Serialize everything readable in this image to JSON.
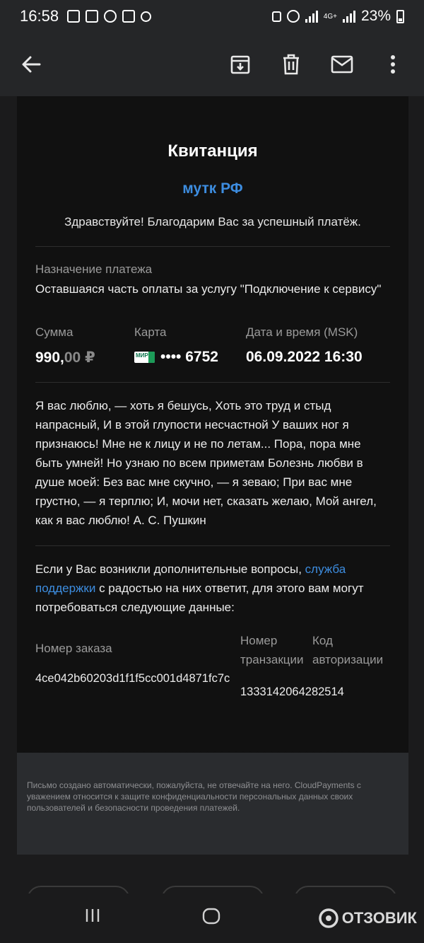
{
  "status_bar": {
    "time": "16:58",
    "network": "4G+",
    "battery": "23%"
  },
  "toolbar": {
    "back_icon": "arrow-left-icon",
    "archive_icon": "archive-icon",
    "delete_icon": "trash-icon",
    "mail_icon": "mail-icon",
    "more_icon": "more-vertical-icon"
  },
  "receipt": {
    "title": "Квитанция",
    "merchant": "мутк РФ",
    "greeting": "Здравствуйте! Благодарим Вас за успешный платёж.",
    "purpose_label": "Назначение платежа",
    "purpose_value": "Оставшаяся часть оплаты за услугу \"Подключение к сервису\"",
    "amount_label": "Сумма",
    "amount_main": "990,",
    "amount_cents": "00 ₽",
    "card_label": "Карта",
    "card_brand": "МИР",
    "card_number": "•••• 6752",
    "datetime_label": "Дата и время (MSK)",
    "datetime_value": "06.09.2022 16:30",
    "message": "Я вас люблю, — хоть я бешусь, Хоть это труд и стыд напрасный, И в этой глупости несчастной У ваших ног я признаюсь! Мне не к лицу и не по летам... Пора, пора мне быть умней! Но узнаю по всем приметам Болезнь любви в душе моей: Без вас мне скучно, — я зеваю; При вас мне грустно, — я терплю; И, мочи нет, сказать желаю, Мой ангел, как я вас люблю! А. С. Пушкин",
    "support_before": "Если у Вас возникли дополнительные вопросы, ",
    "support_link": "служба поддержки",
    "support_after": " с радостью на них ответит, для этого вам могут потребоваться следующие данные:",
    "order_label": "Номер заказа",
    "order_value": "4ce042b60203d1f1f5cc001d4871fc7c",
    "transaction_label": "Номер транзакции",
    "transaction_value": "1333142064282514",
    "auth_label": "Код авторизации"
  },
  "footer": {
    "note": "Письмо создано автоматически, пожалуйста, не отвечайте на него. CloudPayments с уважением относится к защите конфиденциальности персональных данных своих пользователей и безопасности проведения платежей."
  },
  "watermark": {
    "text": "ОТЗОВИК"
  },
  "colors": {
    "accent": "#3d8de0",
    "card_bg": "#111111",
    "page_bg": "#1b1b1c"
  }
}
